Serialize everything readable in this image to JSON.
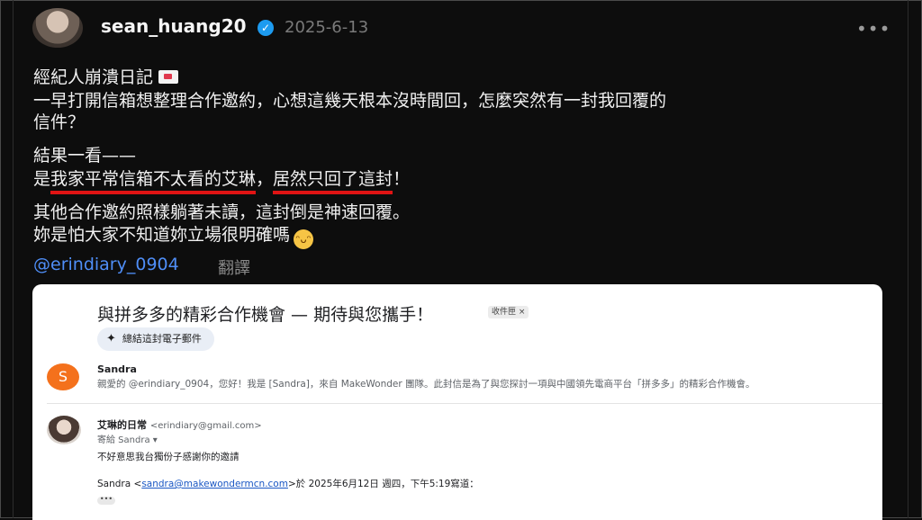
{
  "post": {
    "username": "sean_huang20",
    "verified_icon": "verified-check-icon",
    "date": "2025-6-13",
    "more_icon": "more-horizontal-icon",
    "lines": {
      "l1": "經紀人崩潰日記",
      "l2": "一早打開信箱想整理合作邀約，心想這幾天根本沒時間回，怎麼突然有一封我回覆的",
      "l3": "信件？",
      "l4": "結果一看——",
      "l5_pre": "是",
      "l5_hl1": "我家平常信箱不太看的艾琳",
      "l5_mid": "，",
      "l5_hl2": "居然只回了這封",
      "l5_post": "！",
      "l6": "其他合作邀約照樣躺著未讀，這封倒是神速回覆。",
      "l7": "妳是怕大家不知道妳立場很明確嗎"
    },
    "mention": "@erindiary_0904",
    "translate_label": "翻譯",
    "accent_link_color": "#4f8ef7",
    "underline_color": "#e01414"
  },
  "email": {
    "subject": "與拼多多的精彩合作機會 — 期待與您攜手！",
    "inbox_chip": "收件匣 ×",
    "summary_label": "總結這封電子郵件",
    "first_message": {
      "avatar_letter": "S",
      "sender": "Sandra",
      "snippet": "親愛的 @erindiary_0904，您好！我是 [Sandra]，來自 MakeWonder 團隊。此封信是為了與您探討一項與中國領先電商平台「拼多多」的精彩合作機會。"
    },
    "reply": {
      "sender": "艾琳的日常",
      "address": "<erindiary@gmail.com>",
      "to": "寄給 Sandra ▾",
      "body": "不好意思我台獨份子感謝你的邀請",
      "quote_name": "Sandra <",
      "quote_link": "sandra@makewondermcn.com",
      "quote_rest": ">於 2025年6月12日 週四，下午5:19寫道：",
      "dots": "•••"
    }
  }
}
